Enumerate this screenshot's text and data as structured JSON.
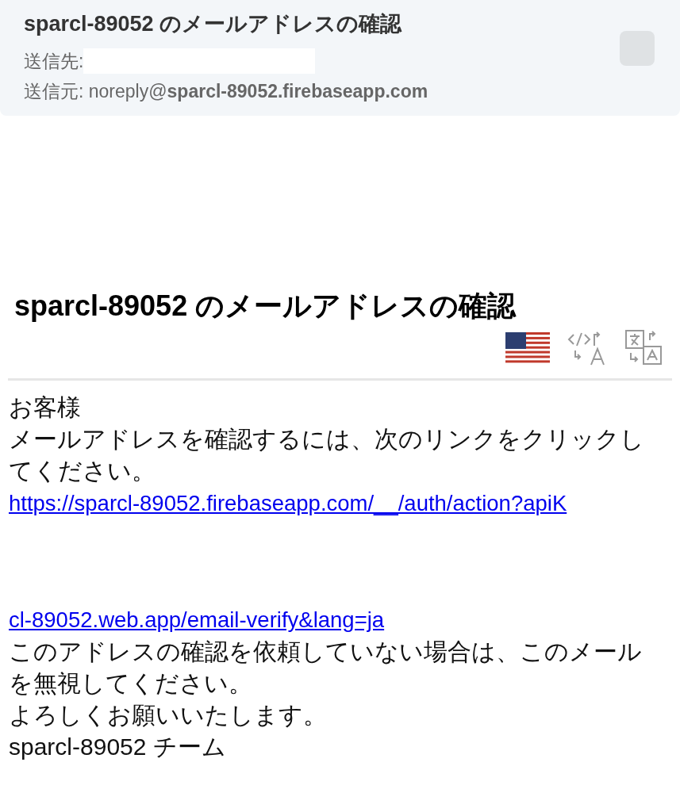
{
  "header": {
    "subject": "sparcl-89052 のメールアドレスの確認",
    "to_label": "送信先:",
    "from_label": "送信元:",
    "from_user": "noreply@",
    "from_domain": "sparcl-89052.firebaseapp.com"
  },
  "body": {
    "title": "sparcl-89052 のメールアドレスの確認",
    "paragraphs": [
      {
        "kind": "text",
        "text": "お客様"
      },
      {
        "kind": "text",
        "text": "メールアドレスを確認するには、次のリンクをクリックしてください。"
      },
      {
        "kind": "link",
        "text": "https://sparcl-89052.firebaseapp.com/__/auth/action?apiK"
      },
      {
        "kind": "gap"
      },
      {
        "kind": "link",
        "text": "cl-89052.web.app/email-verify&lang=ja"
      },
      {
        "kind": "text",
        "text": "このアドレスの確認を依頼していない場合は、このメールを無視してください。"
      },
      {
        "kind": "text",
        "text": "よろしくお願いいたします。"
      },
      {
        "kind": "text",
        "text": "sparcl-89052 チーム"
      }
    ]
  }
}
